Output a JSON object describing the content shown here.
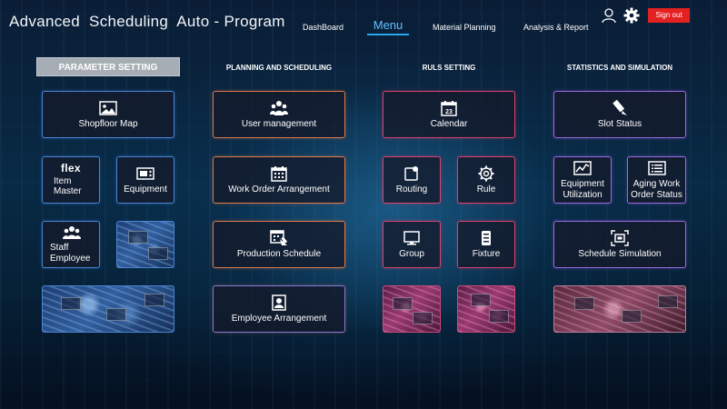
{
  "app": {
    "title": "Advanced  Scheduling  Auto - Program"
  },
  "nav": {
    "dashboard": "DashBoard",
    "menu": "Menu",
    "material_planning": "Material Planning",
    "analysis_report": "Analysis & Report",
    "active": "Menu"
  },
  "header": {
    "signout_label": "Sign out",
    "user_icon": "user-icon",
    "settings_icon": "gear-icon"
  },
  "colors": {
    "accent": "#2aa6f0",
    "signout": "#e42121",
    "border_blue": "#4a86d6",
    "border_orange": "#e07a4a",
    "border_red": "#e0406e",
    "border_purple": "#9b6ae0"
  },
  "sections": {
    "parameter": {
      "title": "PARAMETER SETTING",
      "active": true,
      "tiles": {
        "shopfloor_map": {
          "label": "Shopfloor Map",
          "icon": "image-icon"
        },
        "item_master": {
          "flex": "flex",
          "label_line1": "Item",
          "label_line2": "Master"
        },
        "equipment": {
          "label": "Equipment",
          "icon": "equipment-icon"
        },
        "staff_employee": {
          "label_line1": "Staff",
          "label_line2": "Employee",
          "icon": "people-icon"
        }
      }
    },
    "planning": {
      "title": "PLANNING AND SCHEDULING",
      "tiles": {
        "user_management": {
          "label": "User management",
          "icon": "users-icon"
        },
        "work_order": {
          "label": "Work Order Arrangement",
          "icon": "calendar-grid-icon"
        },
        "production_schedule": {
          "label": "Production Schedule",
          "icon": "schedule-icon"
        },
        "employee_arrangement": {
          "label": "Employee Arrangement",
          "icon": "id-badge-icon"
        }
      }
    },
    "rules": {
      "title": "RULS  SETTING",
      "tiles": {
        "calendar": {
          "label": "Calendar",
          "icon": "calendar-icon",
          "day": "23"
        },
        "routing": {
          "label": "Routing",
          "icon": "routing-icon"
        },
        "rule": {
          "label": "Rule",
          "icon": "gear-icon"
        },
        "group": {
          "label": "Group",
          "icon": "monitor-icon"
        },
        "fixture": {
          "label": "Fixture",
          "icon": "fixture-icon"
        }
      }
    },
    "statistics": {
      "title": "STATISTICS AND SIMULATION",
      "tiles": {
        "slot_status": {
          "label": "Slot Status",
          "icon": "pen-icon"
        },
        "equipment_utilization": {
          "label_line1": "Equipment",
          "label_line2": "Utilization",
          "icon": "chart-icon"
        },
        "aging_work_order": {
          "label_line1": "Aging Work",
          "label_line2": "Order Status",
          "icon": "list-icon"
        },
        "schedule_simulation": {
          "label": "Schedule Simulation",
          "icon": "simulation-icon"
        }
      }
    }
  }
}
